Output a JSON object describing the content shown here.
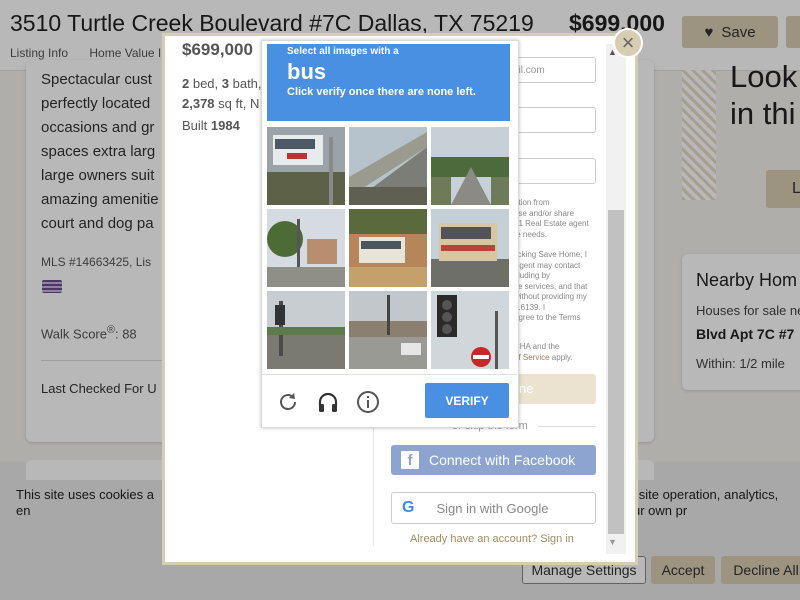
{
  "listing": {
    "address": "3510 Turtle Creek Boulevard #7C Dallas, TX 75219",
    "price": "$699,000",
    "save_label": "Save",
    "tabs": [
      "Listing Info",
      "Home Value I"
    ],
    "description": "Spectacular cust perfectly located occasions and gr spaces extra larg large owners suit amazing amenitie court and dog pa",
    "mls": "MLS #14663425, Lis",
    "walk_score_label": "Walk Score",
    "walk_score_value": "88",
    "last_checked": "Last Checked For U"
  },
  "right_panel": {
    "look_line1": "Look",
    "look_line2": "in thi",
    "button_label": "L",
    "nearby_title": "Nearby Hom",
    "nearby_sub": "Houses for sale ne",
    "nearby_blvd": "Blvd Apt 7C #7",
    "nearby_within": "Within: 1/2 mile"
  },
  "cookie": {
    "text": "This site uses cookies a                                                                                                              at may include site operation, analytics, en                                                                                                        se of these technologies, or manage your own pr",
    "manage_label": "Manage Settings",
    "accept_label": "Accept",
    "decline_label": "Decline All"
  },
  "modal": {
    "close_glyph": "×",
    "price": "$699,000",
    "beds": "2",
    "beds_label": " bed, ",
    "baths": "3",
    "baths_label": " bath,",
    "sqft": "2,378",
    "sqft_label": " sq ft, N",
    "built_label": "Built ",
    "built_year": "1984",
    "email_placeholder": "ail.com",
    "legal1": "ation from\nuse and/or share\n21 Real Estate agent\nte needs.",
    "legal2": "licking Save Home, I\nAgent may contact\ncluding by\nite services, and that\nwithout providing my\n2.6139. I\nagree to the Terms",
    "legal3a": "CHA and the",
    "legal3b": "of Service",
    "legal3c": " apply.",
    "save_home_label": "ne",
    "or_text": "or skip the form",
    "facebook_label": "Connect with Facebook",
    "google_label": "Sign in with Google",
    "already_label": "Already have an account? Sign in"
  },
  "captcha": {
    "instruction_small": "Select all images with a",
    "target_word": "bus",
    "instruction_sub": "Click verify once there are none left.",
    "verify_label": "VERIFY",
    "tiles": [
      "bus",
      "highway",
      "road-trees",
      "street-houses",
      "bus",
      "bus",
      "traffic-light-intersection",
      "intersection-cars",
      "traffic-light-stop-sign"
    ]
  },
  "colors": {
    "accent_gold": "#d8cdb2",
    "captcha_blue": "#4a90e2",
    "facebook": "#8da3d0"
  }
}
